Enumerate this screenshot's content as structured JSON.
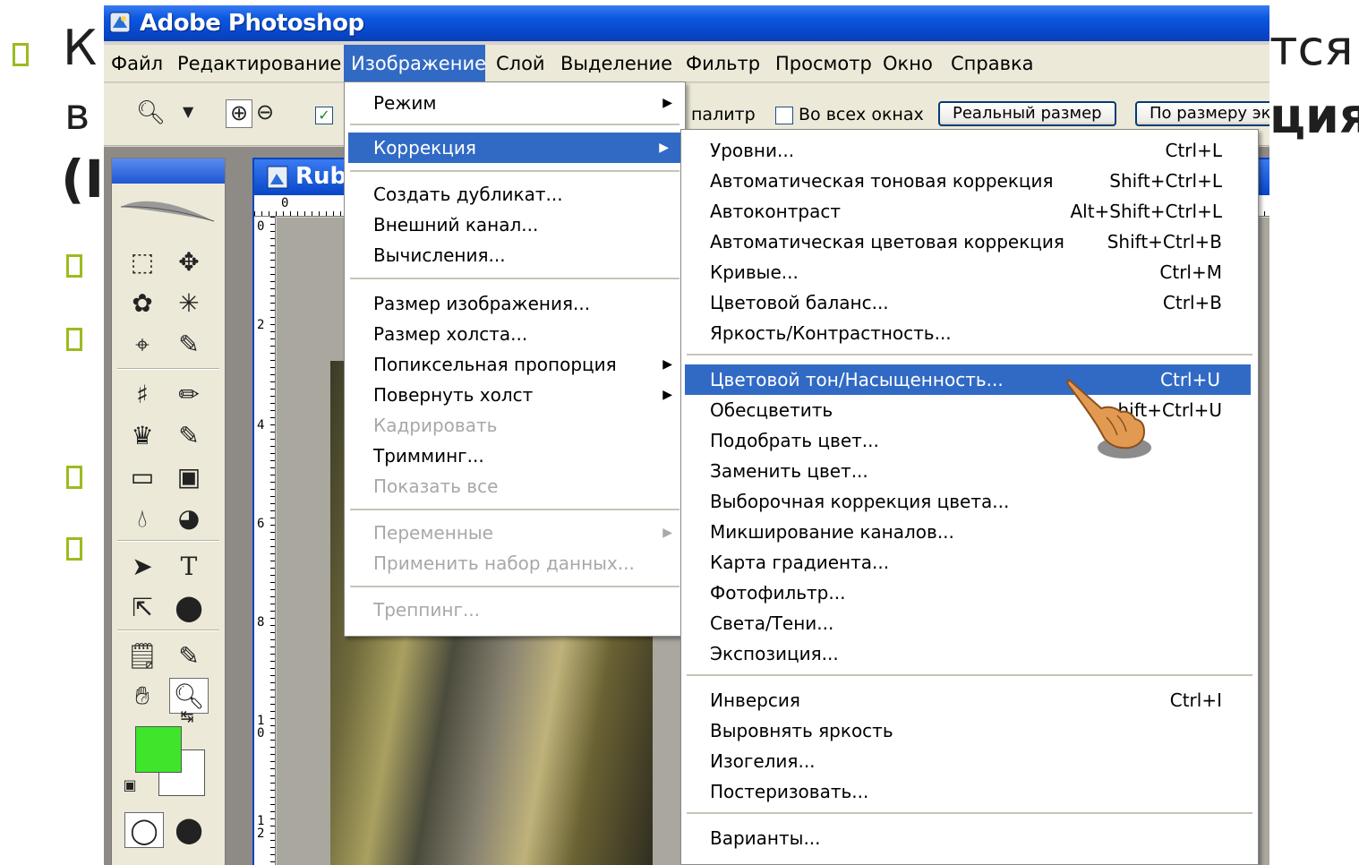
{
  "slide": {
    "line1_left": "К",
    "line1_right": "тся",
    "line2_left": "в",
    "line2_right": "ция",
    "line3_left": "(I"
  },
  "window": {
    "title": "Adobe Photoshop"
  },
  "menubar": {
    "items": [
      "Файл",
      "Редактирование",
      "Изображение",
      "Слой",
      "Выделение",
      "Фильтр",
      "Просмотр",
      "Окно",
      "Справка"
    ],
    "active": "Изображение"
  },
  "options_bar": {
    "palettes_label": "палитр",
    "all_windows_label": "Во всех окнах",
    "actual_pixels_button": "Реальный размер",
    "fit_screen_button": "По размеру эк"
  },
  "document": {
    "title": "Rub",
    "ruler_top_zero": "0",
    "ruler_left": [
      "0",
      "2",
      "4",
      "6",
      "8",
      "1 0",
      "1 2"
    ]
  },
  "image_menu": {
    "items": [
      {
        "label": "Режим",
        "submenu": true
      },
      {
        "label": "Коррекция",
        "submenu": true,
        "highlight": true
      },
      {
        "label": "Создать дубликат..."
      },
      {
        "label": "Внешний канал..."
      },
      {
        "label": "Вычисления..."
      },
      {
        "label": "Размер изображения..."
      },
      {
        "label": "Размер холста..."
      },
      {
        "label": "Попиксельная пропорция",
        "submenu": true
      },
      {
        "label": "Повернуть холст",
        "submenu": true
      },
      {
        "label": "Кадрировать",
        "disabled": true
      },
      {
        "label": "Тримминг..."
      },
      {
        "label": "Показать все",
        "disabled": true
      },
      {
        "label": "Переменные",
        "submenu": true,
        "disabled": true
      },
      {
        "label": "Применить набор данных...",
        "disabled": true
      },
      {
        "label": "Треппинг...",
        "disabled": true
      }
    ]
  },
  "adjustments_menu": {
    "items": [
      {
        "label": "Уровни...",
        "shortcut": "Ctrl+L"
      },
      {
        "label": "Автоматическая тоновая коррекция",
        "shortcut": "Shift+Ctrl+L"
      },
      {
        "label": "Автоконтраст",
        "shortcut": "Alt+Shift+Ctrl+L"
      },
      {
        "label": "Автоматическая цветовая коррекция",
        "shortcut": "Shift+Ctrl+B"
      },
      {
        "label": "Кривые...",
        "shortcut": "Ctrl+M"
      },
      {
        "label": "Цветовой баланс...",
        "shortcut": "Ctrl+B"
      },
      {
        "label": "Яркость/Контрастность...",
        "shortcut": ""
      },
      {
        "label": "Цветовой тон/Насыщенность...",
        "shortcut": "Ctrl+U",
        "highlight": true
      },
      {
        "label": "Обесцветить",
        "shortcut": "hift+Ctrl+U"
      },
      {
        "label": "Подобрать цвет...",
        "shortcut": ""
      },
      {
        "label": "Заменить цвет...",
        "shortcut": ""
      },
      {
        "label": "Выборочная коррекция цвета...",
        "shortcut": ""
      },
      {
        "label": "Микширование каналов...",
        "shortcut": ""
      },
      {
        "label": "Карта градиента...",
        "shortcut": ""
      },
      {
        "label": "Фотофильтр...",
        "shortcut": ""
      },
      {
        "label": "Света/Тени...",
        "shortcut": ""
      },
      {
        "label": "Экспозиция...",
        "shortcut": ""
      },
      {
        "label": "Инверсия",
        "shortcut": "Ctrl+I"
      },
      {
        "label": "Выровнять яркость",
        "shortcut": ""
      },
      {
        "label": "Изогелия...",
        "shortcut": ""
      },
      {
        "label": "Постеризовать...",
        "shortcut": ""
      },
      {
        "label": "Варианты...",
        "shortcut": ""
      }
    ]
  },
  "colors": {
    "menu_highlight": "#316ac5",
    "foreground_swatch": "#3ee52a",
    "bullet": "#9bbb1f"
  }
}
